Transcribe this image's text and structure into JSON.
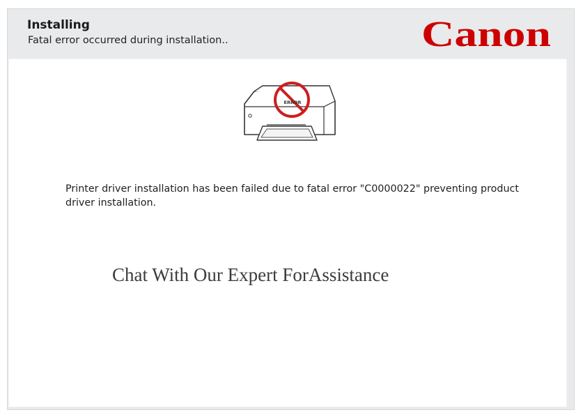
{
  "header": {
    "title": "Installing",
    "subtitle": "Fatal error occurred during installation.."
  },
  "brand": {
    "logo_text": "Canon",
    "color": "#cc0000"
  },
  "illustration": {
    "icon": "printer-error-icon",
    "label": "ERROR"
  },
  "main": {
    "error_message": "Printer driver installation has been failed due to fatal error \"C0000022\" preventing product driver installation.",
    "cta": "Chat With Our Expert ForAssistance"
  }
}
